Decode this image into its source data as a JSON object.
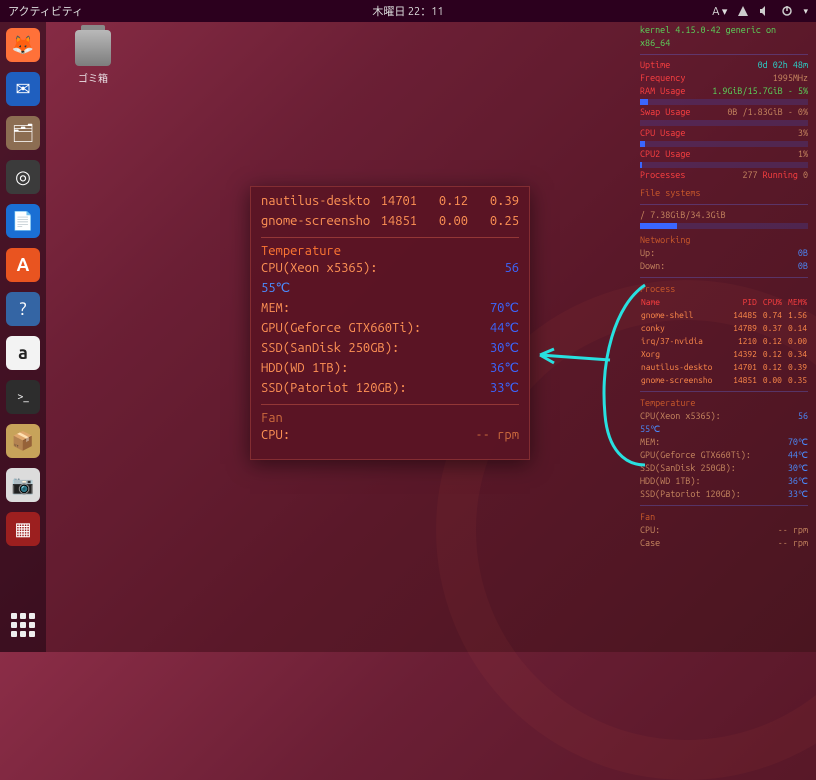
{
  "topbar": {
    "activities": "アクティビティ",
    "clock": "木曜日 22：11",
    "lang_indicator": "A ▾"
  },
  "desktop": {
    "trash_label": "ゴミ箱"
  },
  "dock": {
    "items": [
      {
        "name": "firefox",
        "bg": "#ff7139",
        "glyph": "🦊"
      },
      {
        "name": "thunderbird",
        "bg": "#1f5fbf",
        "glyph": "✉"
      },
      {
        "name": "files",
        "bg": "#8c6d52",
        "glyph": "🗂"
      },
      {
        "name": "rhythmbox",
        "bg": "#3b3b3b",
        "glyph": "◎"
      },
      {
        "name": "libreoffice-writer",
        "bg": "#1a6fd4",
        "glyph": "📄"
      },
      {
        "name": "software",
        "bg": "#e95420",
        "glyph": "A"
      },
      {
        "name": "help",
        "bg": "#3465a4",
        "glyph": "?"
      },
      {
        "name": "amazon",
        "bg": "#f3f3f3",
        "glyph": "a"
      },
      {
        "name": "terminal",
        "bg": "#2d2d2d",
        "glyph": ">_"
      },
      {
        "name": "archive",
        "bg": "#c7a35a",
        "glyph": "📦"
      },
      {
        "name": "screenshot",
        "bg": "#dcdcdc",
        "glyph": "📷"
      },
      {
        "name": "unknown-red",
        "bg": "#9c1f1f",
        "glyph": "▦"
      }
    ]
  },
  "zoom": {
    "proc_rows": [
      {
        "name": "nautilus-deskto",
        "pid": "14701",
        "cpu": "0.12",
        "mem": "0.39"
      },
      {
        "name": "gnome-screensho",
        "pid": "14851",
        "cpu": "0.00",
        "mem": "0.25"
      }
    ],
    "temp_header": "Temperature",
    "temps": [
      {
        "label": "CPU(Xeon x5365):",
        "val": "56"
      },
      {
        "label": "55℃",
        "val": ""
      },
      {
        "label": "MEM:",
        "val": "70℃"
      },
      {
        "label": "GPU(Geforce GTX660Ti):",
        "val": "44℃"
      },
      {
        "label": "SSD(SanDisk 250GB):",
        "val": "30℃"
      },
      {
        "label": "HDD(WD 1TB):",
        "val": "36℃"
      },
      {
        "label": "SSD(Patoriot 120GB):",
        "val": "33℃"
      }
    ],
    "fan_header": "Fan",
    "fan_rows": [
      {
        "label": "CPU:",
        "val": "-- rpm"
      }
    ]
  },
  "conky": {
    "kernel": "kernel 4.15.0-42 generic on x86_64",
    "uptime_label": "Uptime",
    "uptime": "0d 02h 48m",
    "freq_label": "Frequency",
    "freq": "1995MHz",
    "ram_label": "RAM Usage",
    "ram": "1.9GiB/15.7GiB - 5%",
    "swap_label": "Swap Usage",
    "swap": "0B  /1.83GiB - 0%",
    "cpu_label": "CPU Usage",
    "cpu": "3%",
    "cpu2_label": "CPU2 Usage",
    "cpu2": "1%",
    "proc_label": "Processes",
    "proc_total": "277",
    "running_label": "Running",
    "running": "0",
    "fs_header": "File systems",
    "fs_root": "/ 7.38GiB/34.3GiB",
    "net_header": "Networking",
    "net_up_label": "Up:",
    "net_up": "0B",
    "net_down_label": "Down:",
    "net_down": "0B",
    "procs_header": "Process",
    "procs_cols": {
      "c1": "Name",
      "c2": "PID",
      "c3": "CPU%",
      "c4": "MEM%"
    },
    "procs": [
      {
        "n": "gnome-shell",
        "p": "14485",
        "c": "0.74",
        "m": "1.56"
      },
      {
        "n": "conky",
        "p": "14789",
        "c": "0.37",
        "m": "0.14"
      },
      {
        "n": "irq/37-nvidia",
        "p": "1210",
        "c": "0.12",
        "m": "0.00"
      },
      {
        "n": "Xorg",
        "p": "14392",
        "c": "0.12",
        "m": "0.34"
      },
      {
        "n": "nautilus-deskto",
        "p": "14701",
        "c": "0.12",
        "m": "0.39"
      },
      {
        "n": "gnome-screensho",
        "p": "14851",
        "c": "0.00",
        "m": "0.35"
      }
    ],
    "temp_header": "Temperature",
    "temps": [
      {
        "l": "CPU(Xeon x5365):",
        "v": "56"
      },
      {
        "l": "55℃",
        "v": ""
      },
      {
        "l": "MEM:",
        "v": "70℃"
      },
      {
        "l": "GPU(Geforce GTX660Ti):",
        "v": "44℃"
      },
      {
        "l": "SSD(SanDisk 250GB):",
        "v": "30℃"
      },
      {
        "l": "HDD(WD 1TB):",
        "v": "36℃"
      },
      {
        "l": "SSD(Patoriot 120GB):",
        "v": "33℃"
      }
    ],
    "fan_header": "Fan",
    "fans": [
      {
        "l": "CPU:",
        "v": "-- rpm"
      },
      {
        "l": "Case",
        "v": "-- rpm"
      }
    ]
  }
}
